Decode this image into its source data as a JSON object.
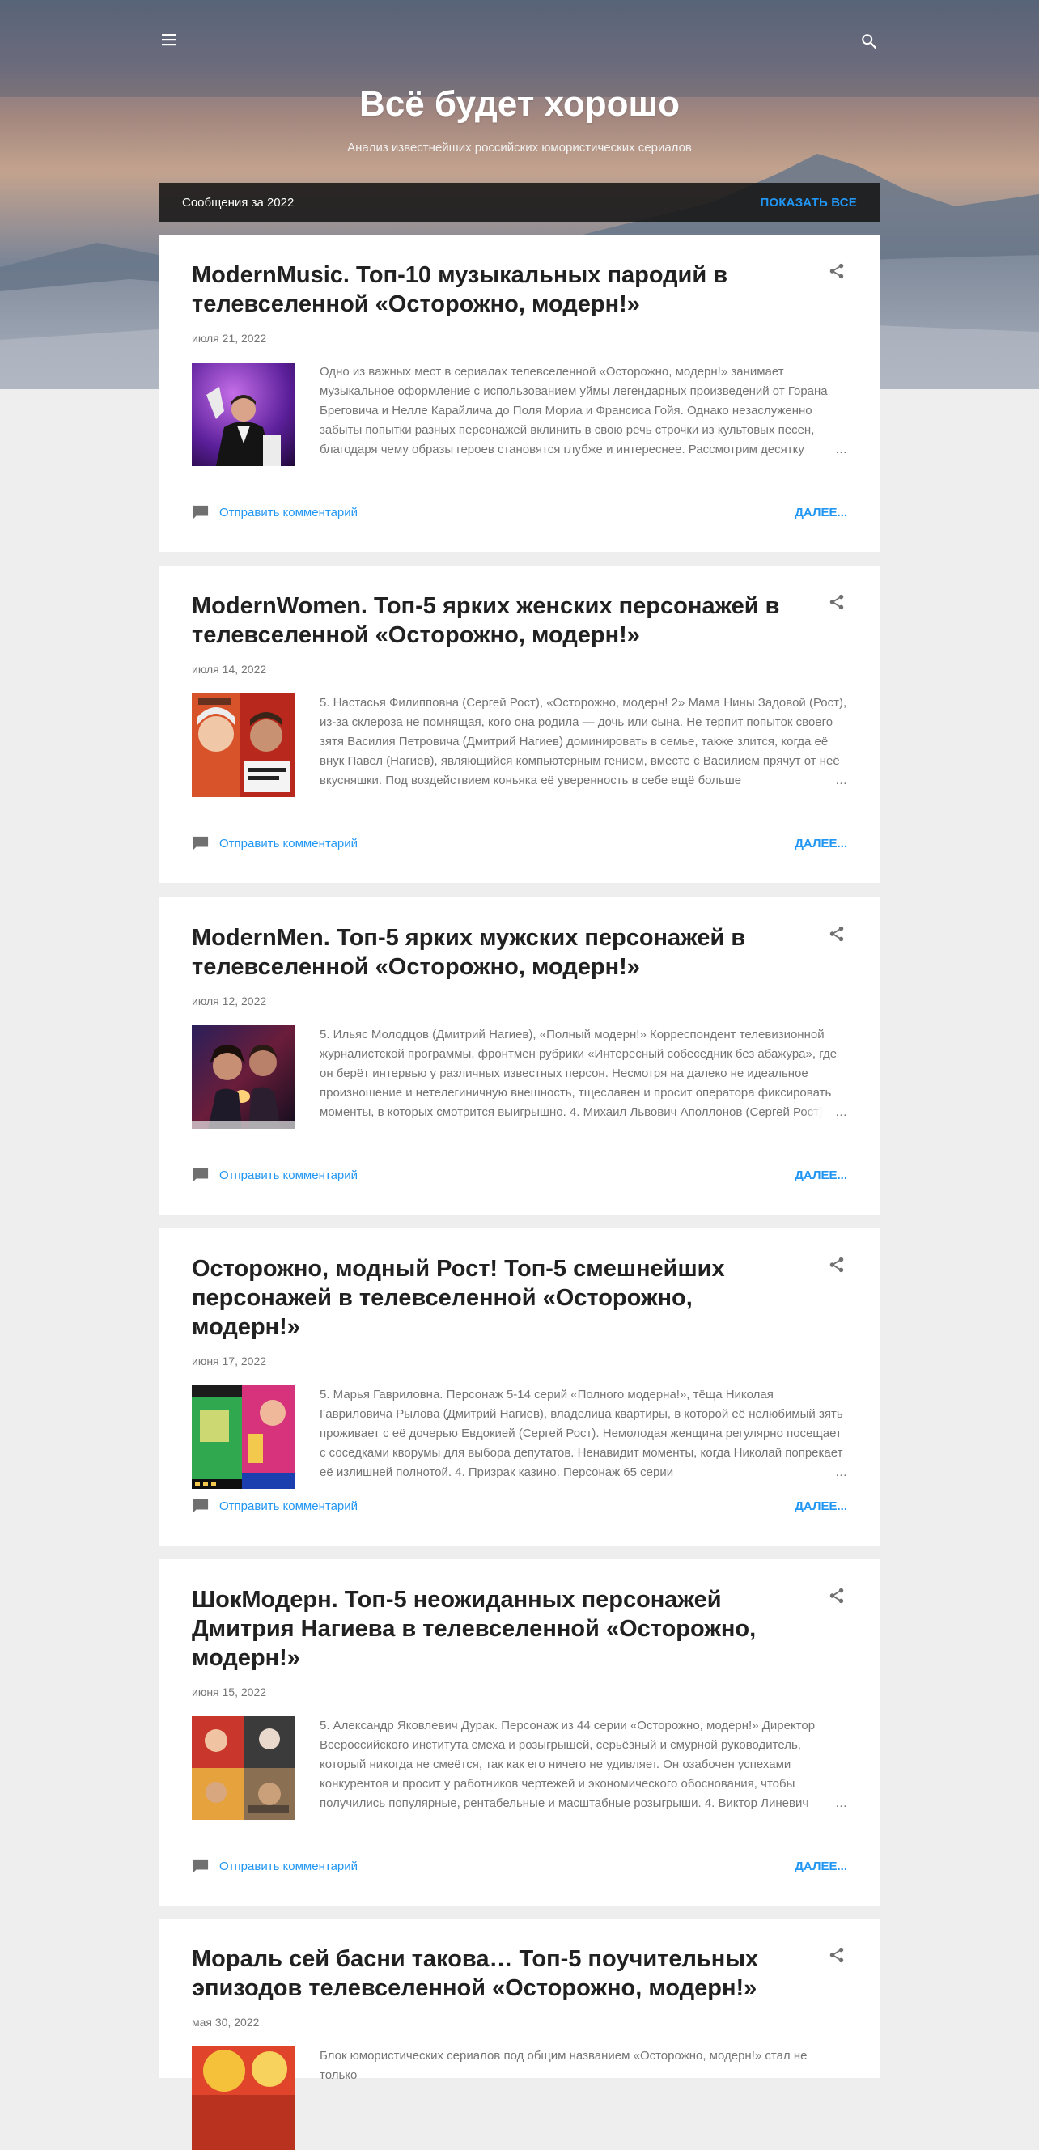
{
  "header": {
    "menu_icon": "menu-icon",
    "search_icon": "search-icon",
    "title": "Всё будет хорошо",
    "description": "Анализ известнейших российских юмористических сериалов"
  },
  "posts_bar": {
    "label": "Сообщения за 2022",
    "show_all": "ПОКАЗАТЬ ВСЕ"
  },
  "posts": [
    {
      "title": "ModernMusic. Топ-10 музыкальных пародий в телевселенной «Осторожно, модерн!»",
      "date": "июля 21, 2022",
      "snippet": "Одно из важных мест в сериалах телевселенной «Осторожно, модерн!» занимает музыкальное оформление с использованием уймы легендарных произведений от Горана Бреговича и Нелле Карайлича до Поля Мориа и Франсиса Гойя. Однако незаслуженно забыты попытки разных персонажей вклинить в свою речь строчки из культовых песен, благодаря чему образы героев становятся глубже и интереснее. Рассмотрим десятку",
      "comment": "Отправить комментарий",
      "more": "ДАЛЕЕ..."
    },
    {
      "title": "ModernWomen. Топ-5 ярких женских персонажей в телевселенной «Осторожно, модерн!»",
      "date": "июля 14, 2022",
      "snippet": "5. Настасья Филипповна (Сергей Рост), «Осторожно, модерн! 2» Мама Нины Задовой (Рост), из-за склероза не помнящая, кого она родила — дочь или сына. Не терпит попыток своего зятя Василия Петровича (Дмитрий Нагиев) доминировать в семье, также злится, когда её внук Павел (Нагиев), являющийся компьютерным гением, вместе с Василием прячут от неё вкусняшки. Под воздействием коньяка её уверенность в себе ещё больше",
      "comment": "Отправить комментарий",
      "more": "ДАЛЕЕ..."
    },
    {
      "title": "ModernMen. Топ-5 ярких мужских персонажей в телевселенной «Осторожно, модерн!»",
      "date": "июля 12, 2022",
      "snippet": "5. Ильяс Молодцов (Дмитрий Нагиев), «Полный модерн!» Корреспондент телевизионной журналистской программы, фронтмен рубрики «Интересный собеседник без абажура», где он берёт интервью у различных известных персон. Несмотря на далеко не идеальное произношение и нетелегиничную внешность, тщеславен и просит оператора фиксировать моменты, в которых смотрится выигрышно. 4. Михаил Львович Аполлонов (Сергей Рост)",
      "comment": "Отправить комментарий",
      "more": "ДАЛЕЕ..."
    },
    {
      "title": "Осторожно, модный Рост! Топ-5 смешнейших персонажей в телевселенной «Осторожно, модерн!»",
      "date": "июня 17, 2022",
      "snippet": "5. Марья Гавриловна. Персонаж 5-14 серий «Полного модерна!», тёща Николая Гавриловича Рылова (Дмитрий Нагиев), владелица квартиры, в которой её нелюбимый зять проживает с её дочерью Евдокией (Сергей Рост). Немолодая женщина регулярно посещает с соседками кворумы для выбора депутатов. Ненавидит моменты, когда Николай попрекает её излишней полнотой. 4. Призрак казино. Персонаж 65 серии",
      "comment": "Отправить комментарий",
      "more": "ДАЛЕЕ..."
    },
    {
      "title": "ШокМодерн. Топ-5 неожиданных персонажей Дмитрия Нагиева в телевселенной «Осторожно, модерн!»",
      "date": "июня 15, 2022",
      "snippet": "5. Александр Яковлевич Дурак. Персонаж из 44 серии «Осторожно, модерн!» Директор Всероссийского института смеха и розыгрышей, серьёзный и смурной руководитель, который никогда не смеётся, так как его ничего не удивляет. Он озабочен успехами конкурентов и просит у работников чертежей и экономического обоснования, чтобы получились популярные, рентабельные и масштабные розыгрыши. 4. Виктор Линевич",
      "comment": "Отправить комментарий",
      "more": "ДАЛЕЕ..."
    },
    {
      "title": "Мораль сей басни такова… Топ-5 поучительных эпизодов телевселенной «Осторожно, модерн!»",
      "date": "мая 30, 2022",
      "snippet": "Блок юмористических сериалов под общим названием «Осторожно, модерн!» стал не только"
    }
  ],
  "icons": {
    "share": "share-icon",
    "comment": "comment-icon"
  },
  "colors": {
    "accent": "#2196f3",
    "title": "#212121",
    "meta": "#757575",
    "page_bg": "#eeeeee",
    "card_bg": "#ffffff"
  }
}
